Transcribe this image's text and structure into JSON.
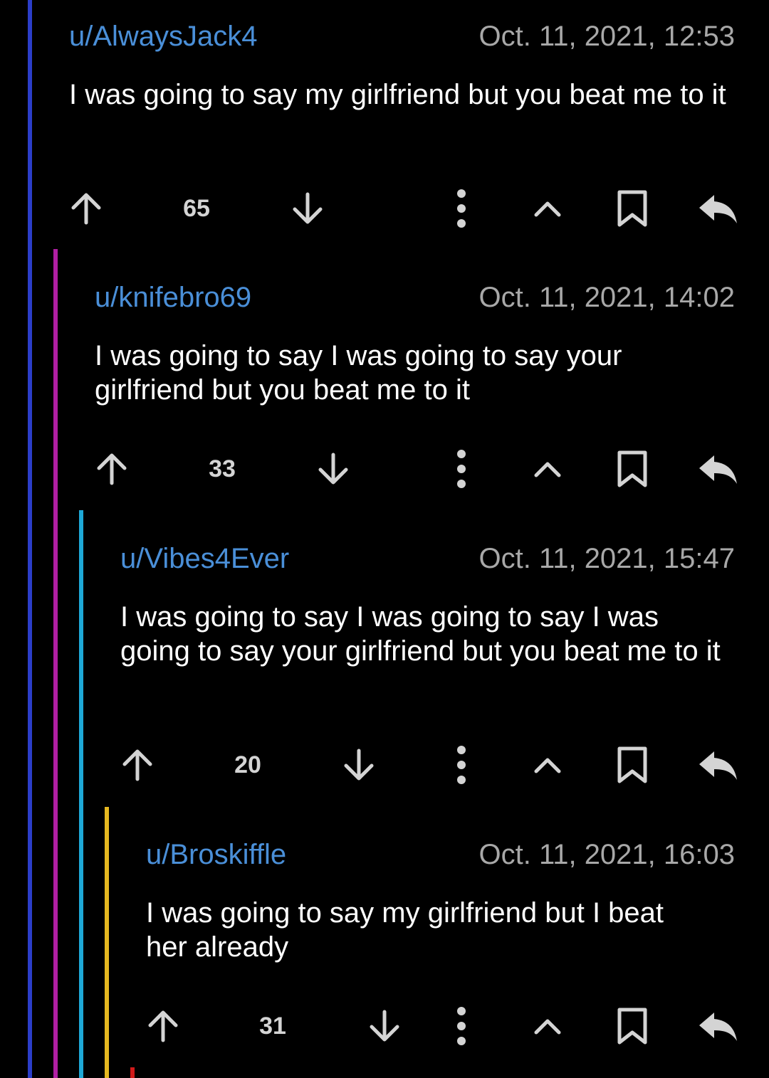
{
  "colors": {
    "background": "#000000",
    "username": "#4a8fd8",
    "timestamp": "#a8a8a8",
    "body_text": "#ffffff",
    "icon": "#d4d4d4",
    "thread_level_1": "#2b3ec9",
    "thread_level_2": "#b01fa3",
    "thread_level_3": "#1ea8d6",
    "thread_level_4": "#e6b820",
    "thread_level_5": "#d11a1a"
  },
  "comments": [
    {
      "username": "u/AlwaysJack4",
      "timestamp": "Oct. 11, 2021, 12:53",
      "body": "I was going to say my girlfriend but you beat me to it",
      "score": "65"
    },
    {
      "username": "u/knifebro69",
      "timestamp": "Oct. 11, 2021, 14:02",
      "body": "I was going to say I was going to say your girlfriend but you beat me to it",
      "score": "33"
    },
    {
      "username": "u/Vibes4Ever",
      "timestamp": "Oct. 11, 2021, 15:47",
      "body": "I was going to say I was going to say I was going to say your girlfriend but you beat me to it",
      "score": "20"
    },
    {
      "username": "u/Broskiffle",
      "timestamp": "Oct. 11, 2021, 16:03",
      "body": "I was going to say my girlfriend but I beat her already",
      "score": "31"
    }
  ],
  "icons": {
    "upvote": "arrow-up-icon",
    "downvote": "arrow-down-icon",
    "more": "more-vertical-icon",
    "collapse": "chevron-up-icon",
    "save": "bookmark-icon",
    "reply": "reply-icon"
  }
}
